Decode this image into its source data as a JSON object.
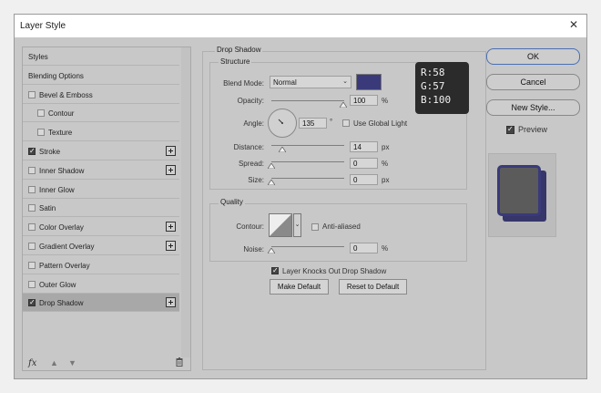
{
  "window": {
    "title": "Layer Style",
    "close_glyph": "✕"
  },
  "sidebar": {
    "items": [
      {
        "label": "Styles",
        "checkbox": false,
        "checked": false,
        "plus": false,
        "indent": 0
      },
      {
        "label": "Blending Options",
        "checkbox": false,
        "checked": false,
        "plus": false,
        "indent": 0
      },
      {
        "label": "Bevel & Emboss",
        "checkbox": true,
        "checked": false,
        "plus": false,
        "indent": 0
      },
      {
        "label": "Contour",
        "checkbox": true,
        "checked": false,
        "plus": false,
        "indent": 1
      },
      {
        "label": "Texture",
        "checkbox": true,
        "checked": false,
        "plus": false,
        "indent": 1
      },
      {
        "label": "Stroke",
        "checkbox": true,
        "checked": true,
        "plus": true,
        "indent": 0
      },
      {
        "label": "Inner Shadow",
        "checkbox": true,
        "checked": false,
        "plus": true,
        "indent": 0
      },
      {
        "label": "Inner Glow",
        "checkbox": true,
        "checked": false,
        "plus": false,
        "indent": 0
      },
      {
        "label": "Satin",
        "checkbox": true,
        "checked": false,
        "plus": false,
        "indent": 0
      },
      {
        "label": "Color Overlay",
        "checkbox": true,
        "checked": false,
        "plus": true,
        "indent": 0
      },
      {
        "label": "Gradient Overlay",
        "checkbox": true,
        "checked": false,
        "plus": true,
        "indent": 0
      },
      {
        "label": "Pattern Overlay",
        "checkbox": true,
        "checked": false,
        "plus": false,
        "indent": 0
      },
      {
        "label": "Outer Glow",
        "checkbox": true,
        "checked": false,
        "plus": false,
        "indent": 0
      },
      {
        "label": "Drop Shadow",
        "checkbox": true,
        "checked": true,
        "plus": true,
        "indent": 0,
        "active": true
      }
    ],
    "footer": {
      "fx_label": "fx",
      "fx_icon": "fx-icon",
      "up_icon": "move-up-icon",
      "down_icon": "move-down-icon",
      "trash_icon": "trash-icon"
    }
  },
  "drop_shadow": {
    "section_title": "Drop Shadow",
    "structure": {
      "title": "Structure",
      "blend_mode_label": "Blend Mode:",
      "blend_mode_value": "Normal",
      "shadow_color": "#3a3a7a",
      "opacity_label": "Opacity:",
      "opacity_value": "100",
      "opacity_unit": "%",
      "angle_label": "Angle:",
      "angle_value": "135",
      "angle_unit": "°",
      "global_light_label": "Use Global Light",
      "global_light_checked": false,
      "distance_label": "Distance:",
      "distance_value": "14",
      "distance_unit": "px",
      "spread_label": "Spread:",
      "spread_value": "0",
      "spread_unit": "%",
      "size_label": "Size:",
      "size_value": "0",
      "size_unit": "px"
    },
    "quality": {
      "title": "Quality",
      "contour_label": "Contour:",
      "anti_aliased_label": "Anti-aliased",
      "anti_aliased_checked": false,
      "noise_label": "Noise:",
      "noise_value": "0",
      "noise_unit": "%"
    },
    "knocks_out_label": "Layer Knocks Out Drop Shadow",
    "knocks_out_checked": true,
    "make_default_label": "Make Default",
    "reset_default_label": "Reset to Default"
  },
  "rgb_readout": {
    "r": "R:58",
    "g": "G:57",
    "b": "B:100"
  },
  "actions": {
    "ok_label": "OK",
    "cancel_label": "Cancel",
    "new_style_label": "New Style...",
    "preview_label": "Preview",
    "preview_checked": true
  },
  "colors": {
    "dialog_bg": "#c8c8c8",
    "shadow_color": "#3a3a7a",
    "preview_fill": "#5b5b5b",
    "active_row": "#a8a8a8"
  }
}
